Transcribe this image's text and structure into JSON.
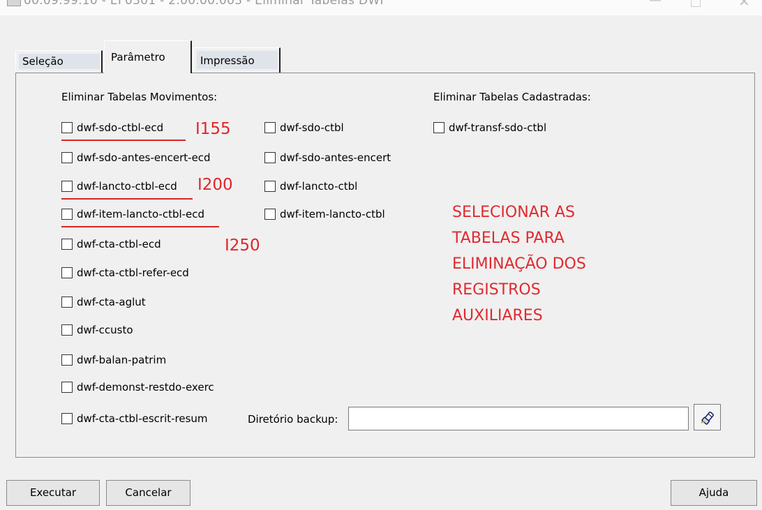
{
  "window": {
    "title": "00.09.99.10 - EF0301 - 2.00.00.003 - Eliminar Tabelas DWF"
  },
  "tabs": [
    {
      "label": "Seleção",
      "active": false
    },
    {
      "label": "Parâmetro",
      "active": true
    },
    {
      "label": "Impressão",
      "active": false
    }
  ],
  "movimentos": {
    "heading": "Eliminar Tabelas Movimentos:",
    "col1": [
      {
        "label": "dwf-sdo-ctbl-ecd",
        "checked": false
      },
      {
        "label": "dwf-sdo-antes-encert-ecd",
        "checked": false
      },
      {
        "label": "dwf-lancto-ctbl-ecd",
        "checked": false
      },
      {
        "label": "dwf-item-lancto-ctbl-ecd",
        "checked": false
      },
      {
        "label": "dwf-cta-ctbl-ecd",
        "checked": false
      },
      {
        "label": "dwf-cta-ctbl-refer-ecd",
        "checked": false
      },
      {
        "label": "dwf-cta-aglut",
        "checked": false
      },
      {
        "label": "dwf-ccusto",
        "checked": false
      },
      {
        "label": "dwf-balan-patrim",
        "checked": false
      },
      {
        "label": "dwf-demonst-restdo-exerc",
        "checked": false
      },
      {
        "label": "dwf-cta-ctbl-escrit-resum",
        "checked": false
      }
    ],
    "col2": [
      {
        "label": "dwf-sdo-ctbl",
        "checked": false
      },
      {
        "label": "dwf-sdo-antes-encert",
        "checked": false
      },
      {
        "label": "dwf-lancto-ctbl",
        "checked": false
      },
      {
        "label": "dwf-item-lancto-ctbl",
        "checked": false
      }
    ]
  },
  "cadastradas": {
    "heading": "Eliminar Tabelas Cadastradas:",
    "items": [
      {
        "label": "dwf-transf-sdo-ctbl",
        "checked": false
      }
    ]
  },
  "annotations": {
    "i155": "I155",
    "i200": "I200",
    "i250": "I250",
    "note_lines": [
      "SELECIONAR AS",
      "TABELAS PARA",
      "ELIMINAÇÃO DOS",
      "REGISTROS",
      "AUXILIARES"
    ],
    "color": "#e0252a"
  },
  "backup": {
    "label": "Diretório backup:",
    "value": ""
  },
  "buttons": {
    "executar": "Executar",
    "cancelar": "Cancelar",
    "ajuda": "Ajuda"
  }
}
